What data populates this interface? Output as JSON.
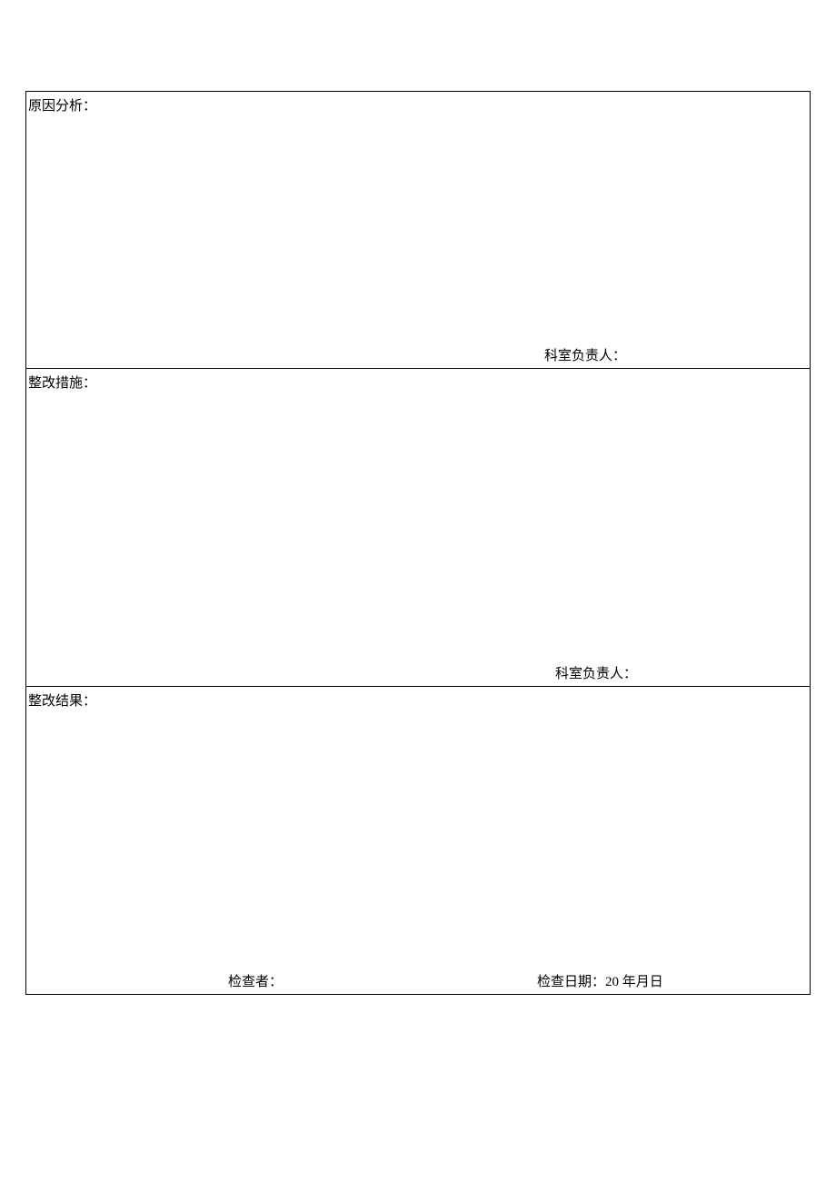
{
  "sections": {
    "analysis": {
      "label": "原因分析：",
      "signer": "科室负责人："
    },
    "measures": {
      "label": "整改措施：",
      "signer": "科室负责人："
    },
    "result": {
      "label": "整改结果：",
      "inspector": "检查者：",
      "date": "检查日期：20 年月日"
    }
  }
}
